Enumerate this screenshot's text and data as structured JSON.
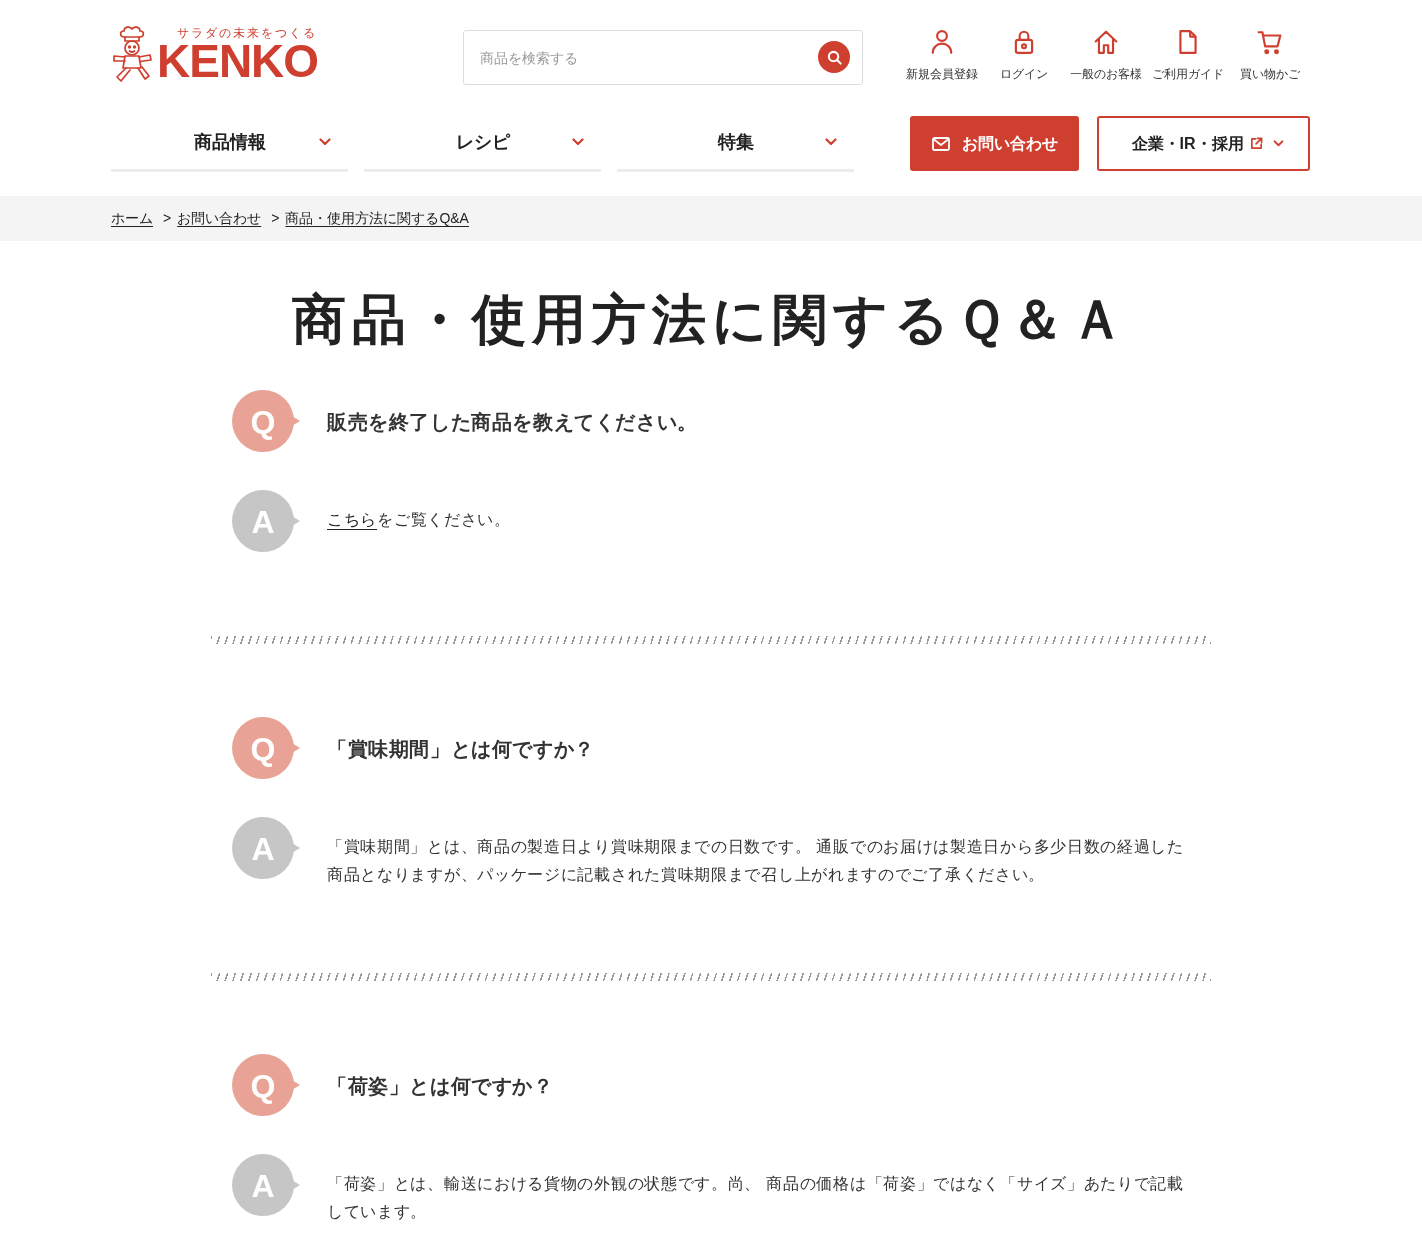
{
  "header": {
    "logo": {
      "tagline": "サラダの未来をつくる",
      "wordmark": "KENKO"
    },
    "search": {
      "placeholder": "商品を検索する"
    },
    "utility_links": [
      {
        "kind": "user",
        "label": "新規会員登録"
      },
      {
        "kind": "lock",
        "label": "ログイン"
      },
      {
        "kind": "home",
        "label": "一般のお客様"
      },
      {
        "kind": "document",
        "label": "ご利用ガイド"
      },
      {
        "kind": "cart",
        "label": "買い物かご"
      }
    ]
  },
  "nav": {
    "tabs": [
      {
        "label": "商品情報"
      },
      {
        "label": "レシピ"
      },
      {
        "label": "特集"
      }
    ],
    "contact_button": {
      "label": "お問い合わせ"
    },
    "corporate_button": {
      "label": "企業・IR・採用"
    }
  },
  "breadcrumb": [
    {
      "label": "ホーム"
    },
    {
      "separator": ">",
      "label": "お問い合わせ"
    },
    {
      "separator": ">",
      "label": "商品・使用方法に関するQ&A"
    }
  ],
  "title": "商品・使用方法に関するＱ＆Ａ",
  "faq": [
    {
      "question": {
        "mark": "Q",
        "text": "販売を終了した商品を教えてください。"
      },
      "answer": {
        "mark": "A",
        "parts": [
          {
            "kind": "link",
            "text": "こちら"
          },
          {
            "kind": "text",
            "text": "をご覧ください。"
          }
        ]
      }
    },
    {
      "question": {
        "mark": "Q",
        "text": "「賞味期間」とは何ですか？"
      },
      "answer": {
        "mark": "A",
        "parts": [
          {
            "kind": "text",
            "text": "「賞味期間」とは、商品の製造日より賞味期限までの日数です。 通販でのお届けは製造日から多少日数の経過した商品となりますが、パッケージに記載された賞味期限まで召し上がれますのでご了承ください。"
          }
        ]
      }
    },
    {
      "question": {
        "mark": "Q",
        "text": "「荷姿」とは何ですか？"
      },
      "answer": {
        "mark": "A",
        "parts": [
          {
            "kind": "text",
            "text": "「荷姿」とは、輸送における貨物の外観の状態です。尚、 商品の価格は「荷姿」ではなく「サイズ」あたりで記載しています。"
          }
        ]
      }
    }
  ]
}
